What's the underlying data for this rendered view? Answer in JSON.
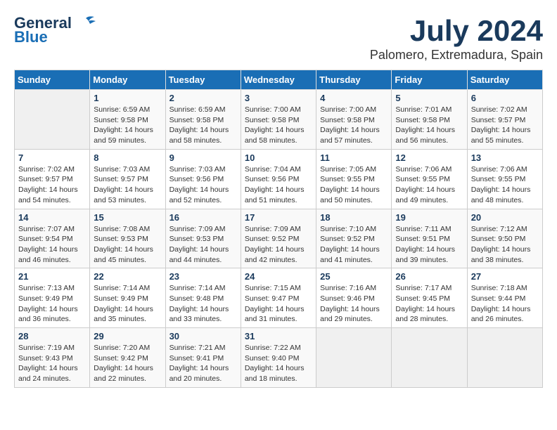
{
  "header": {
    "logo_line1": "General",
    "logo_line2": "Blue",
    "title": "July 2024",
    "subtitle": "Palomero, Extremadura, Spain"
  },
  "days_of_week": [
    "Sunday",
    "Monday",
    "Tuesday",
    "Wednesday",
    "Thursday",
    "Friday",
    "Saturday"
  ],
  "weeks": [
    [
      {
        "day": "",
        "info": ""
      },
      {
        "day": "1",
        "info": "Sunrise: 6:59 AM\nSunset: 9:58 PM\nDaylight: 14 hours and 59 minutes."
      },
      {
        "day": "2",
        "info": "Sunrise: 6:59 AM\nSunset: 9:58 PM\nDaylight: 14 hours and 58 minutes."
      },
      {
        "day": "3",
        "info": "Sunrise: 7:00 AM\nSunset: 9:58 PM\nDaylight: 14 hours and 58 minutes."
      },
      {
        "day": "4",
        "info": "Sunrise: 7:00 AM\nSunset: 9:58 PM\nDaylight: 14 hours and 57 minutes."
      },
      {
        "day": "5",
        "info": "Sunrise: 7:01 AM\nSunset: 9:58 PM\nDaylight: 14 hours and 56 minutes."
      },
      {
        "day": "6",
        "info": "Sunrise: 7:02 AM\nSunset: 9:57 PM\nDaylight: 14 hours and 55 minutes."
      }
    ],
    [
      {
        "day": "7",
        "info": "Sunrise: 7:02 AM\nSunset: 9:57 PM\nDaylight: 14 hours and 54 minutes."
      },
      {
        "day": "8",
        "info": "Sunrise: 7:03 AM\nSunset: 9:57 PM\nDaylight: 14 hours and 53 minutes."
      },
      {
        "day": "9",
        "info": "Sunrise: 7:03 AM\nSunset: 9:56 PM\nDaylight: 14 hours and 52 minutes."
      },
      {
        "day": "10",
        "info": "Sunrise: 7:04 AM\nSunset: 9:56 PM\nDaylight: 14 hours and 51 minutes."
      },
      {
        "day": "11",
        "info": "Sunrise: 7:05 AM\nSunset: 9:55 PM\nDaylight: 14 hours and 50 minutes."
      },
      {
        "day": "12",
        "info": "Sunrise: 7:06 AM\nSunset: 9:55 PM\nDaylight: 14 hours and 49 minutes."
      },
      {
        "day": "13",
        "info": "Sunrise: 7:06 AM\nSunset: 9:55 PM\nDaylight: 14 hours and 48 minutes."
      }
    ],
    [
      {
        "day": "14",
        "info": "Sunrise: 7:07 AM\nSunset: 9:54 PM\nDaylight: 14 hours and 46 minutes."
      },
      {
        "day": "15",
        "info": "Sunrise: 7:08 AM\nSunset: 9:53 PM\nDaylight: 14 hours and 45 minutes."
      },
      {
        "day": "16",
        "info": "Sunrise: 7:09 AM\nSunset: 9:53 PM\nDaylight: 14 hours and 44 minutes."
      },
      {
        "day": "17",
        "info": "Sunrise: 7:09 AM\nSunset: 9:52 PM\nDaylight: 14 hours and 42 minutes."
      },
      {
        "day": "18",
        "info": "Sunrise: 7:10 AM\nSunset: 9:52 PM\nDaylight: 14 hours and 41 minutes."
      },
      {
        "day": "19",
        "info": "Sunrise: 7:11 AM\nSunset: 9:51 PM\nDaylight: 14 hours and 39 minutes."
      },
      {
        "day": "20",
        "info": "Sunrise: 7:12 AM\nSunset: 9:50 PM\nDaylight: 14 hours and 38 minutes."
      }
    ],
    [
      {
        "day": "21",
        "info": "Sunrise: 7:13 AM\nSunset: 9:49 PM\nDaylight: 14 hours and 36 minutes."
      },
      {
        "day": "22",
        "info": "Sunrise: 7:14 AM\nSunset: 9:49 PM\nDaylight: 14 hours and 35 minutes."
      },
      {
        "day": "23",
        "info": "Sunrise: 7:14 AM\nSunset: 9:48 PM\nDaylight: 14 hours and 33 minutes."
      },
      {
        "day": "24",
        "info": "Sunrise: 7:15 AM\nSunset: 9:47 PM\nDaylight: 14 hours and 31 minutes."
      },
      {
        "day": "25",
        "info": "Sunrise: 7:16 AM\nSunset: 9:46 PM\nDaylight: 14 hours and 29 minutes."
      },
      {
        "day": "26",
        "info": "Sunrise: 7:17 AM\nSunset: 9:45 PM\nDaylight: 14 hours and 28 minutes."
      },
      {
        "day": "27",
        "info": "Sunrise: 7:18 AM\nSunset: 9:44 PM\nDaylight: 14 hours and 26 minutes."
      }
    ],
    [
      {
        "day": "28",
        "info": "Sunrise: 7:19 AM\nSunset: 9:43 PM\nDaylight: 14 hours and 24 minutes."
      },
      {
        "day": "29",
        "info": "Sunrise: 7:20 AM\nSunset: 9:42 PM\nDaylight: 14 hours and 22 minutes."
      },
      {
        "day": "30",
        "info": "Sunrise: 7:21 AM\nSunset: 9:41 PM\nDaylight: 14 hours and 20 minutes."
      },
      {
        "day": "31",
        "info": "Sunrise: 7:22 AM\nSunset: 9:40 PM\nDaylight: 14 hours and 18 minutes."
      },
      {
        "day": "",
        "info": ""
      },
      {
        "day": "",
        "info": ""
      },
      {
        "day": "",
        "info": ""
      }
    ]
  ]
}
